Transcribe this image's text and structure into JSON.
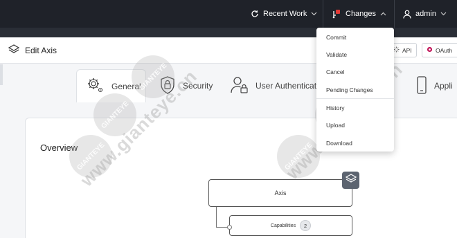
{
  "topbar": {
    "recent_work_label": "Recent Work",
    "changes_label": "Changes",
    "user_label": "admin",
    "colors": {
      "background": "#1f2229",
      "changes_flag": "#e53935"
    }
  },
  "page_header": {
    "title": "Edit Axis",
    "buttons": [
      {
        "label": "API",
        "icon": "api-icon"
      },
      {
        "label": "OAuth",
        "icon": "oauth-gear-icon"
      }
    ]
  },
  "tabs": [
    {
      "label": "General",
      "icon": "gear-icon",
      "active": true
    },
    {
      "label": "Security",
      "icon": "shield-lock-icon",
      "active": false
    },
    {
      "label": "User Authenticatio",
      "icon": "user-lock-icon",
      "active": false
    },
    {
      "label": "Appli",
      "icon": "mobile-icon",
      "active": false
    }
  ],
  "panel": {
    "title": "Overview",
    "nodes": {
      "axis_label": "Axis",
      "capabilities_label": "Capabilities",
      "capabilities_count": "2"
    }
  },
  "changes_menu": {
    "items": [
      {
        "label": "Commit"
      },
      {
        "label": "Validate"
      },
      {
        "label": "Cancel"
      },
      {
        "label": "Pending Changes"
      },
      {
        "label": "History"
      },
      {
        "label": "Upload"
      },
      {
        "label": "Download"
      }
    ]
  },
  "watermark": {
    "text": "www.gianteye.cn",
    "badge": "GIANTEYE"
  }
}
